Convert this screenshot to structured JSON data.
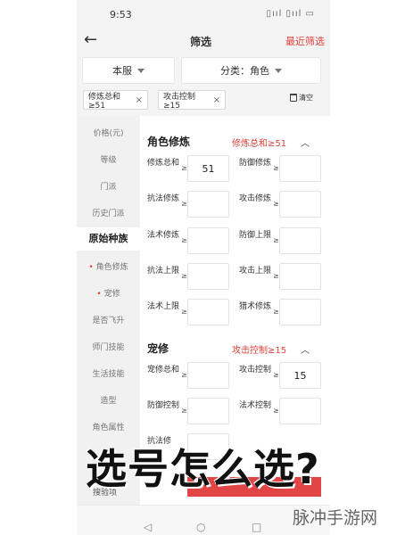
{
  "status_bar": {
    "time": "9:53",
    "icons_text": "▯ııl ▯ııl ▭"
  },
  "header": {
    "back": "←",
    "title": "筛选",
    "recent": "最近筛选"
  },
  "dropdowns": {
    "server": "本服",
    "category": "分类：角色"
  },
  "chips": [
    {
      "label": "修炼总和≥51",
      "close": "×"
    },
    {
      "label": "攻击控制≥15",
      "close": "×"
    }
  ],
  "clear_label": "清空",
  "sidebar": {
    "items": [
      {
        "label": "价格(元)"
      },
      {
        "label": "等级"
      },
      {
        "label": "门派"
      },
      {
        "label": "历史门派"
      },
      {
        "label": "原始种族"
      },
      {
        "label": "角色修炼"
      },
      {
        "label": "宠修"
      },
      {
        "label": "是否飞升"
      },
      {
        "label": "师门技能"
      },
      {
        "label": "生活技能"
      },
      {
        "label": "造型"
      },
      {
        "label": "角色属性"
      }
    ],
    "partial_bottom": "搜验项"
  },
  "sections": [
    {
      "title": "角色修炼",
      "tag": "修炼总和≥51",
      "arrow": "︿",
      "fields": [
        {
          "label": "修炼总和",
          "ge": "≥",
          "value": "51"
        },
        {
          "label": "防御修炼",
          "ge": "≥",
          "value": ""
        },
        {
          "label": "抗法修炼",
          "ge": "≥",
          "value": ""
        },
        {
          "label": "攻击修炼",
          "ge": "≥",
          "value": ""
        },
        {
          "label": "法术修炼",
          "ge": "≥",
          "value": ""
        },
        {
          "label": "防御上限",
          "ge": "≥",
          "value": ""
        },
        {
          "label": "抗法上限",
          "ge": "≥",
          "value": ""
        },
        {
          "label": "攻击上限",
          "ge": "≥",
          "value": ""
        },
        {
          "label": "法术上限",
          "ge": "≥",
          "value": ""
        },
        {
          "label": "猎术修炼",
          "ge": "≥",
          "value": ""
        }
      ]
    },
    {
      "title": "宠修",
      "tag": "攻击控制≥15",
      "arrow": "︿",
      "fields": [
        {
          "label": "宠修总和",
          "ge": "≥",
          "value": ""
        },
        {
          "label": "攻击控制",
          "ge": "≥",
          "value": "15"
        },
        {
          "label": "防御控制",
          "ge": "≥",
          "value": ""
        },
        {
          "label": "法术控制",
          "ge": "≥",
          "value": ""
        },
        {
          "label": "抗法修",
          "ge": "",
          "value": ""
        }
      ]
    }
  ],
  "overlay": {
    "headline": "选号怎么选?",
    "watermark": "脉冲手游网"
  },
  "nav": {
    "back": "◁",
    "home": "○",
    "recent": "□"
  },
  "colors": {
    "accent": "#e0413a",
    "overlay_bar": "#e14545"
  }
}
